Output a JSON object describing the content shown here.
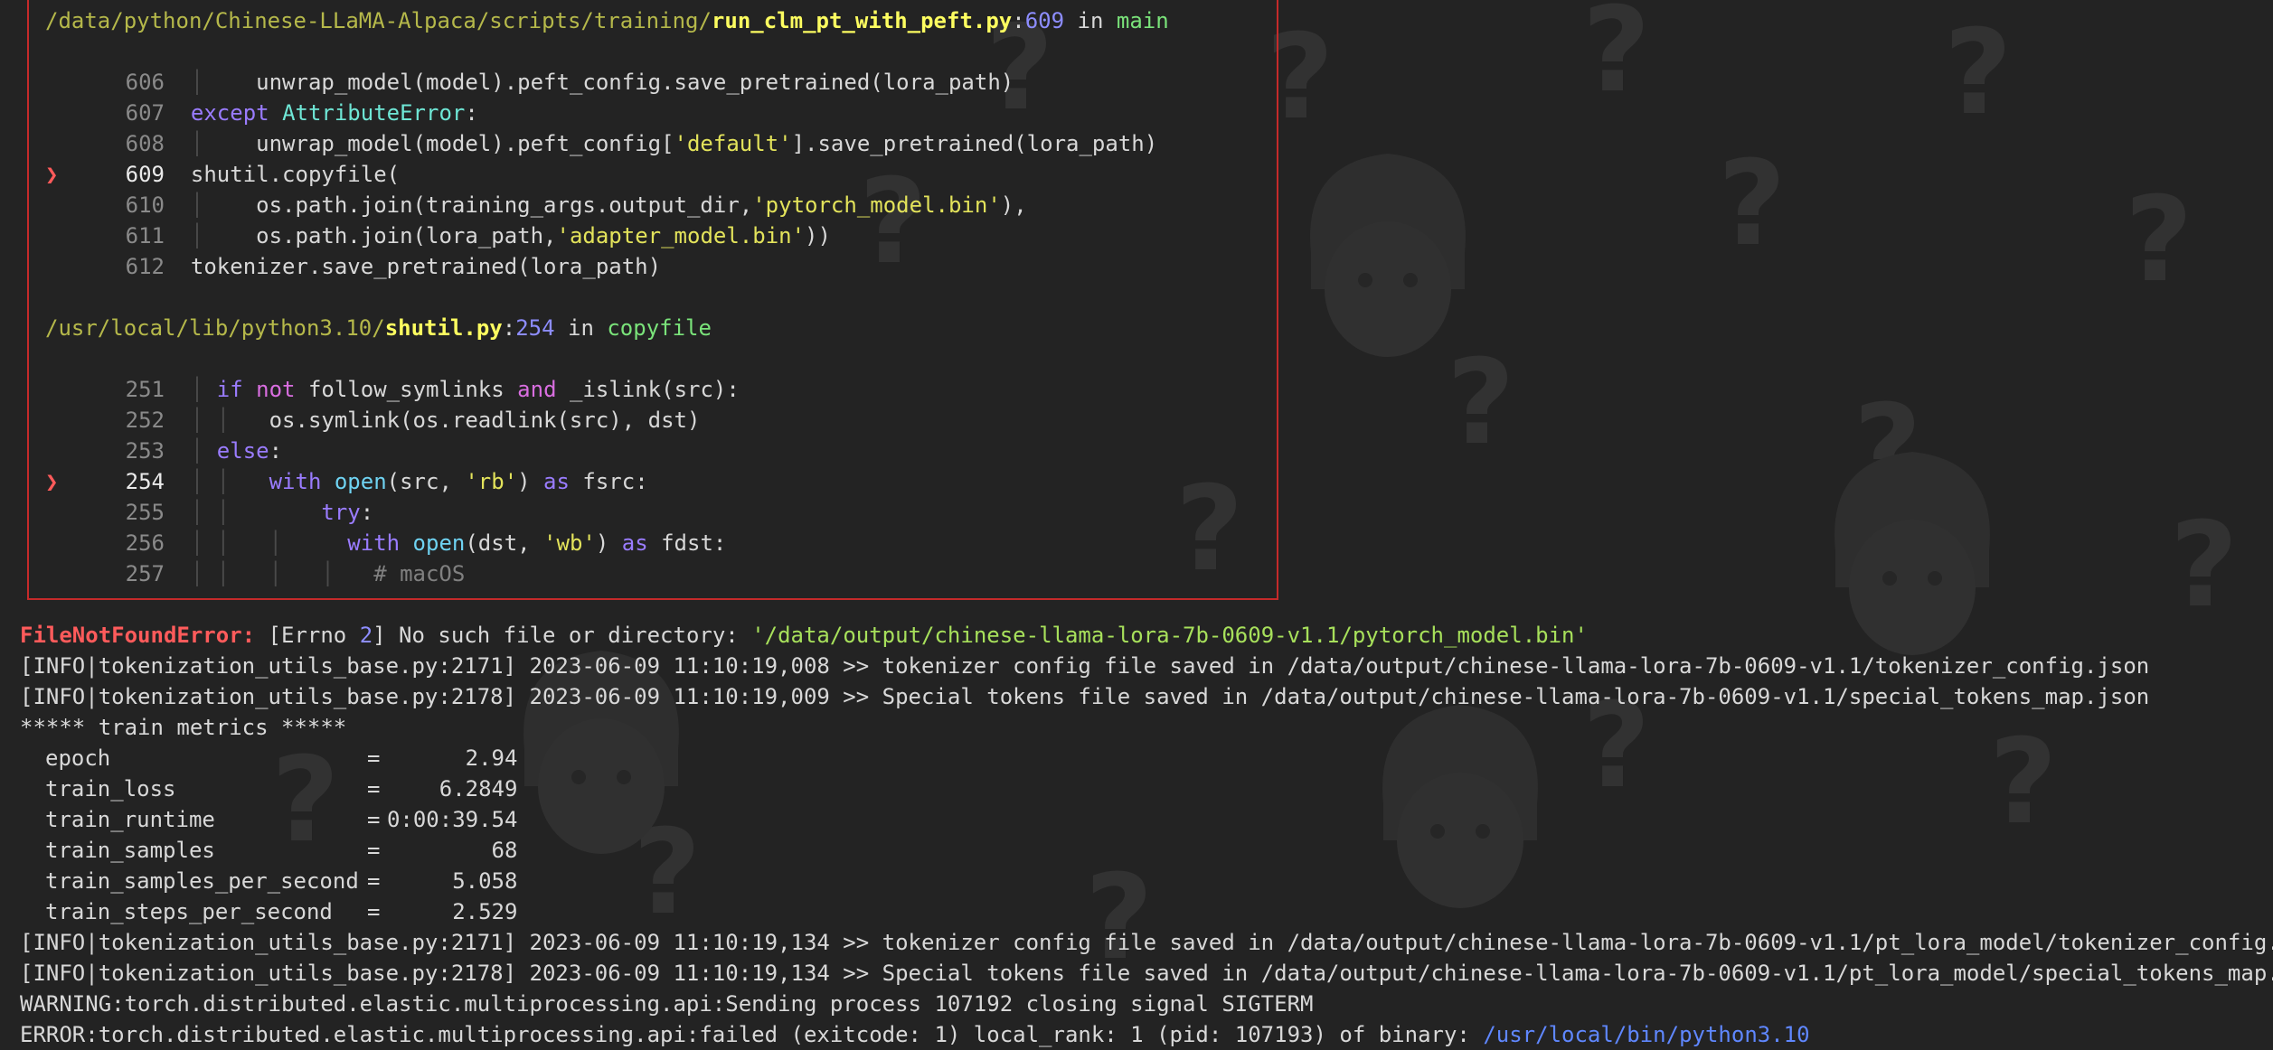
{
  "traceback": {
    "frame1": {
      "dir": "/data/python/Chinese-LLaMA-Alpaca/scripts/training/",
      "file": "run_clm_pt_with_peft.py",
      "lineno": "609",
      "in_word": "in",
      "func": "main",
      "lines": [
        {
          "n": "606",
          "marker": ""
        },
        {
          "n": "607",
          "marker": ""
        },
        {
          "n": "608",
          "marker": ""
        },
        {
          "n": "609",
          "marker": "❯"
        },
        {
          "n": "610",
          "marker": ""
        },
        {
          "n": "611",
          "marker": ""
        },
        {
          "n": "612",
          "marker": ""
        }
      ],
      "code": {
        "l606": "unwrap_model(model).peft_config.save_pretrained(lora_path)",
        "l607_kw": "except",
        "l607_cls": "AttributeError",
        "l607_tail": ":",
        "l608_a": "unwrap_model(model).peft_config[",
        "l608_str": "'default'",
        "l608_b": "].save_pretrained(lora_path)",
        "l609": "shutil.copyfile(",
        "l610_a": "os.path.join(training_args.output_dir,",
        "l610_str": "'pytorch_model.bin'",
        "l610_b": "),",
        "l611_a": "os.path.join(lora_path,",
        "l611_str": "'adapter_model.bin'",
        "l611_b": "))",
        "l612": "tokenizer.save_pretrained(lora_path)"
      }
    },
    "frame2": {
      "dir": "/usr/local/lib/python3.10/",
      "file": "shutil.py",
      "lineno": "254",
      "in_word": "in",
      "func": "copyfile",
      "lines": [
        {
          "n": "251",
          "marker": ""
        },
        {
          "n": "252",
          "marker": ""
        },
        {
          "n": "253",
          "marker": ""
        },
        {
          "n": "254",
          "marker": "❯"
        },
        {
          "n": "255",
          "marker": ""
        },
        {
          "n": "256",
          "marker": ""
        },
        {
          "n": "257",
          "marker": ""
        }
      ],
      "code": {
        "l251_if": "if",
        "l251_not": "not",
        "l251_a": "follow_symlinks",
        "l251_and": "and",
        "l251_b": "_islink(src):",
        "l252": "os.symlink(os.readlink(src), dst)",
        "l253_kw": "else",
        "l253_tail": ":",
        "l254_with": "with",
        "l254_open": "open",
        "l254_a": "(src,",
        "l254_str": "'rb'",
        "l254_b": ")",
        "l254_as": "as",
        "l254_c": "fsrc:",
        "l255_kw": "try",
        "l255_tail": ":",
        "l256_with": "with",
        "l256_open": "open",
        "l256_a": "(dst,",
        "l256_str": "'wb'",
        "l256_b": ")",
        "l256_as": "as",
        "l256_c": "fdst:",
        "l257": "# macOS"
      }
    }
  },
  "error": {
    "type": "FileNotFoundError:",
    "bracket_open": "[Errno",
    "errno": "2",
    "message": "] No such file or directory:",
    "path": "'/data/output/chinese-llama-lora-7b-0609-v1.1/pytorch_model.bin'"
  },
  "log": {
    "info1": "[INFO|tokenization_utils_base.py:2171] 2023-06-09 11:10:19,008 >> tokenizer config file saved in /data/output/chinese-llama-lora-7b-0609-v1.1/tokenizer_config.json",
    "info2": "[INFO|tokenization_utils_base.py:2178] 2023-06-09 11:10:19,009 >> Special tokens file saved in /data/output/chinese-llama-lora-7b-0609-v1.1/special_tokens_map.json",
    "metrics_header": "***** train metrics *****",
    "metrics": [
      {
        "key": "epoch",
        "value": "2.94"
      },
      {
        "key": "train_loss",
        "value": "6.2849"
      },
      {
        "key": "train_runtime",
        "value": "0:00:39.54"
      },
      {
        "key": "train_samples",
        "value": "68"
      },
      {
        "key": "train_samples_per_second",
        "value": "5.058"
      },
      {
        "key": "train_steps_per_second",
        "value": "2.529"
      }
    ],
    "info3": "[INFO|tokenization_utils_base.py:2171] 2023-06-09 11:10:19,134 >> tokenizer config file saved in /data/output/chinese-llama-lora-7b-0609-v1.1/pt_lora_model/tokenizer_config.json",
    "info4": "[INFO|tokenization_utils_base.py:2178] 2023-06-09 11:10:19,134 >> Special tokens file saved in /data/output/chinese-llama-lora-7b-0609-v1.1/pt_lora_model/special_tokens_map.json",
    "warning": "WARNING:torch.distributed.elastic.multiprocessing.api:Sending process 107192 closing signal SIGTERM",
    "error_prefix": "ERROR:torch.distributed.elastic.multiprocessing.api:failed (exitcode: 1) local_rank: 1 (pid: 107193) of binary:",
    "error_binary": "/usr/local/bin/python3.10"
  }
}
